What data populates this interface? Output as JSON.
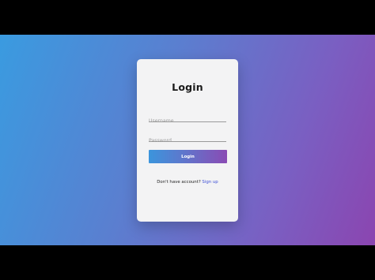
{
  "login_card": {
    "title": "Login",
    "username": {
      "value": "",
      "placeholder": "Username"
    },
    "password": {
      "value": "",
      "placeholder": "Password"
    },
    "submit_label": "Login",
    "signup_prompt": "Don't have account?",
    "signup_link": "Sign up"
  },
  "colors": {
    "background_start": "#3a9be0",
    "background_end": "#8b45b0",
    "card": "#f3f3f4",
    "link": "#3d4fd6"
  }
}
